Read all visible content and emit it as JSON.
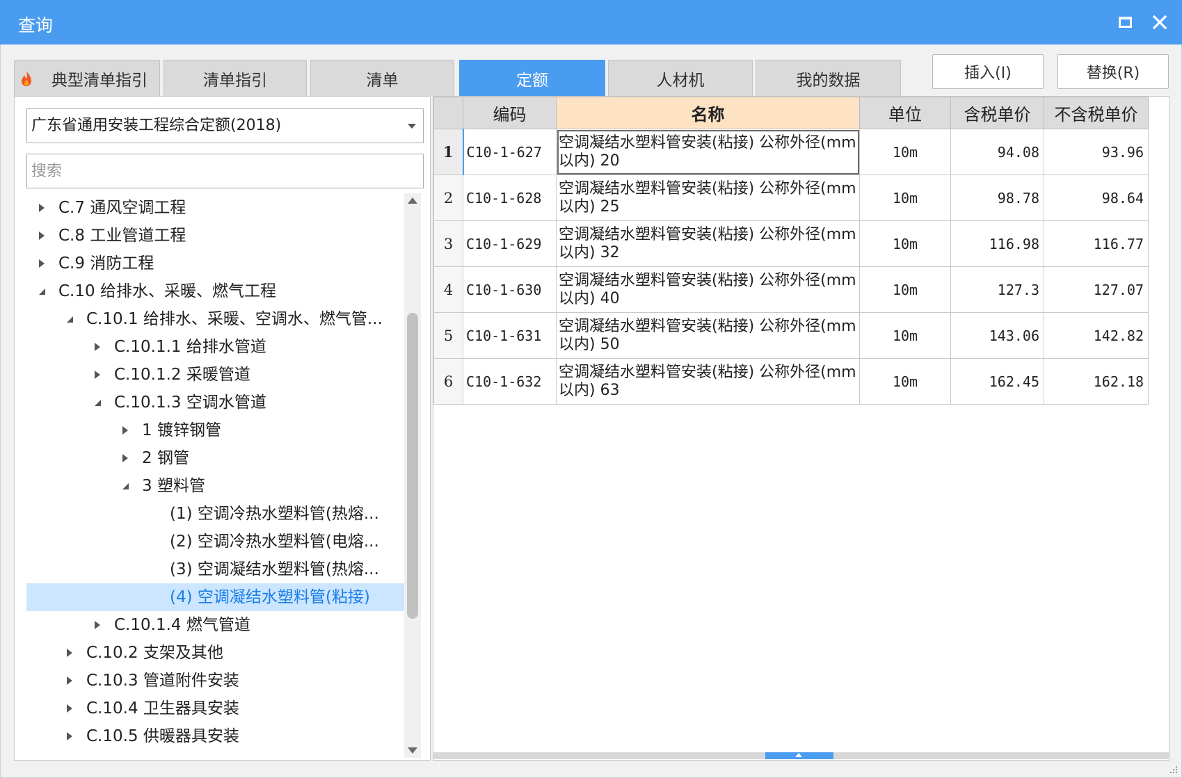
{
  "window": {
    "title": "查询"
  },
  "tabs": [
    {
      "label": "典型清单指引",
      "active": false
    },
    {
      "label": "清单指引",
      "active": false
    },
    {
      "label": "清单",
      "active": false
    },
    {
      "label": "定额",
      "active": true
    },
    {
      "label": "人材机",
      "active": false
    },
    {
      "label": "我的数据",
      "active": false
    }
  ],
  "actions": {
    "insert": "插入(I)",
    "replace": "替换(R)"
  },
  "left": {
    "quota_library": "广东省通用安装工程综合定额(2018)",
    "search_placeholder": "搜索",
    "tree": [
      {
        "label": "C.7 通风空调工程",
        "state": "collapsed",
        "level": 0
      },
      {
        "label": "C.8 工业管道工程",
        "state": "collapsed",
        "level": 0
      },
      {
        "label": "C.9 消防工程",
        "state": "collapsed",
        "level": 0
      },
      {
        "label": "C.10 给排水、采暖、燃气工程",
        "state": "expanded",
        "level": 0
      },
      {
        "label": "C.10.1 给排水、采暖、空调水、燃气管...",
        "state": "expanded",
        "level": 1
      },
      {
        "label": "C.10.1.1 给排水管道",
        "state": "collapsed",
        "level": 2
      },
      {
        "label": "C.10.1.2 采暖管道",
        "state": "collapsed",
        "level": 2
      },
      {
        "label": "C.10.1.3 空调水管道",
        "state": "expanded",
        "level": 2
      },
      {
        "label": "1 镀锌钢管",
        "state": "collapsed",
        "level": 3
      },
      {
        "label": "2 钢管",
        "state": "collapsed",
        "level": 3
      },
      {
        "label": "3 塑料管",
        "state": "expanded",
        "level": 3
      },
      {
        "label": "(1) 空调冷热水塑料管(热熔...",
        "state": "leaf",
        "level": 4
      },
      {
        "label": "(2) 空调冷热水塑料管(电熔...",
        "state": "leaf",
        "level": 4
      },
      {
        "label": "(3) 空调凝结水塑料管(热熔...",
        "state": "leaf",
        "level": 4
      },
      {
        "label": "(4) 空调凝结水塑料管(粘接)",
        "state": "leaf",
        "level": 4,
        "selected": true
      },
      {
        "label": "C.10.1.4 燃气管道",
        "state": "collapsed",
        "level": 2
      },
      {
        "label": "C.10.2 支架及其他",
        "state": "collapsed",
        "level": 1
      },
      {
        "label": "C.10.3 管道附件安装",
        "state": "collapsed",
        "level": 1
      },
      {
        "label": "C.10.4 卫生器具安装",
        "state": "collapsed",
        "level": 1
      },
      {
        "label": "C.10.5 供暖器具安装",
        "state": "collapsed",
        "level": 1
      }
    ]
  },
  "grid": {
    "columns": [
      "编码",
      "名称",
      "单位",
      "含税单价",
      "不含税单价"
    ],
    "rows": [
      {
        "idx": "1",
        "code": "C10-1-627",
        "name": "空调凝结水塑料管安装(粘接) 公称外径(mm以内) 20",
        "unit": "10m",
        "tax_price": "94.08",
        "notax_price": "93.96"
      },
      {
        "idx": "2",
        "code": "C10-1-628",
        "name": "空调凝结水塑料管安装(粘接) 公称外径(mm以内) 25",
        "unit": "10m",
        "tax_price": "98.78",
        "notax_price": "98.64"
      },
      {
        "idx": "3",
        "code": "C10-1-629",
        "name": "空调凝结水塑料管安装(粘接) 公称外径(mm以内) 32",
        "unit": "10m",
        "tax_price": "116.98",
        "notax_price": "116.77"
      },
      {
        "idx": "4",
        "code": "C10-1-630",
        "name": "空调凝结水塑料管安装(粘接) 公称外径(mm以内) 40",
        "unit": "10m",
        "tax_price": "127.3",
        "notax_price": "127.07"
      },
      {
        "idx": "5",
        "code": "C10-1-631",
        "name": "空调凝结水塑料管安装(粘接) 公称外径(mm以内) 50",
        "unit": "10m",
        "tax_price": "143.06",
        "notax_price": "142.82"
      },
      {
        "idx": "6",
        "code": "C10-1-632",
        "name": "空调凝结水塑料管安装(粘接) 公称外径(mm以内) 63",
        "unit": "10m",
        "tax_price": "162.45",
        "notax_price": "162.18"
      }
    ]
  },
  "colors": {
    "accent": "#4a9cf0",
    "selected_row": "#cce6ff",
    "header_name": "#fde2c4"
  }
}
